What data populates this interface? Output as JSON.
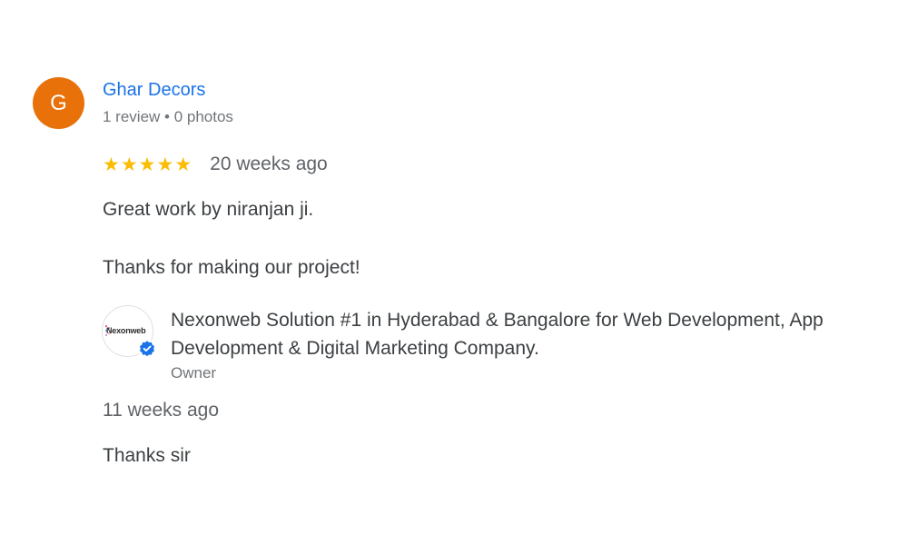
{
  "review": {
    "avatar_initial": "G",
    "avatar_color": "#e8710a",
    "reviewer_name": "Ghar Decors",
    "reviewer_meta": "1 review • 0 photos",
    "rating": 5,
    "stars": [
      "★",
      "★",
      "★",
      "★",
      "★"
    ],
    "date": "20 weeks ago",
    "text_lines": [
      "Great work by niranjan ji.",
      "Thanks for making our project!"
    ]
  },
  "owner_reply": {
    "logo_text": "Nexonweb",
    "owner_name": "Nexonweb Solution #1 in Hyderabad & Bangalore for Web Development, App Development & Digital Marketing Company.",
    "role": "Owner",
    "date": "11 weeks ago",
    "text": "Thanks sir",
    "badge_color": "#1a73e8"
  }
}
